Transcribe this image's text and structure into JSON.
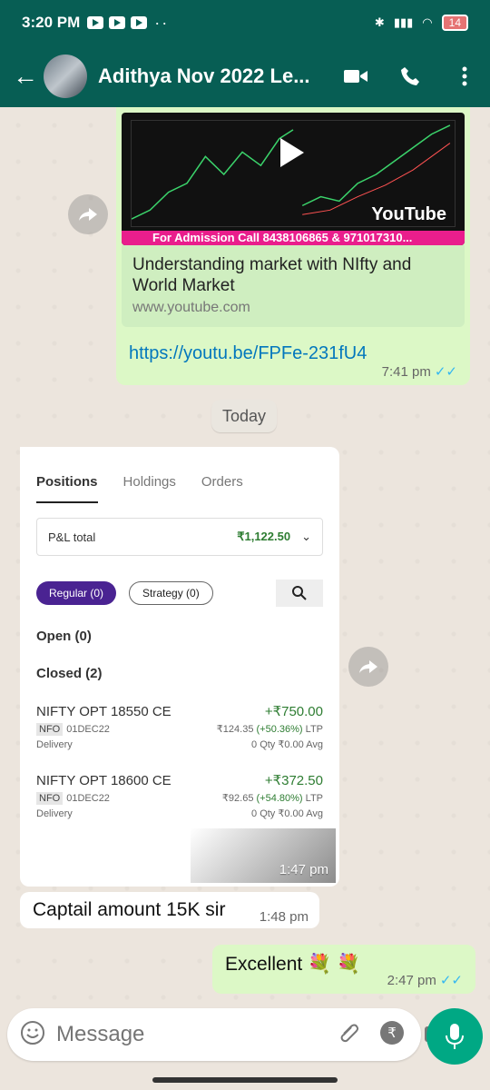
{
  "status_bar": {
    "time": "3:20 PM",
    "battery": "14"
  },
  "app_bar": {
    "title": "Adithya  Nov 2022 Le..."
  },
  "messages": {
    "link_preview": {
      "banner": "For Admission Call 8438106865 & 971017310...",
      "youtube_label": "YouTube",
      "title": "Understanding market with NIfty and World Market",
      "domain": "www.youtube.com",
      "url": "https://youtu.be/FPFe-231fU4",
      "time": "7:41 pm"
    },
    "date_divider": "Today",
    "screenshot": {
      "tabs": [
        "Positions",
        "Holdings",
        "Orders"
      ],
      "pl_label": "P&L total",
      "pl_value": "₹1,122.50",
      "chips": [
        "Regular (0)",
        "Strategy (0)"
      ],
      "open_label": "Open (0)",
      "closed_label": "Closed (2)",
      "positions": [
        {
          "symbol": "NIFTY OPT 18550 CE",
          "pnl": "+₹750.00",
          "exchange": "NFO",
          "expiry": "01DEC22",
          "ltp_price": "₹124.35",
          "ltp_change": "(+50.36%)",
          "ltp_label": "LTP",
          "product": "Delivery",
          "qty": "0 Qty",
          "avg": "₹0.00 Avg"
        },
        {
          "symbol": "NIFTY OPT 18600 CE",
          "pnl": "+₹372.50",
          "exchange": "NFO",
          "expiry": "01DEC22",
          "ltp_price": "₹92.65",
          "ltp_change": "(+54.80%)",
          "ltp_label": "LTP",
          "product": "Delivery",
          "qty": "0 Qty",
          "avg": "₹0.00 Avg"
        }
      ],
      "time": "1:47 pm"
    },
    "incoming_text": {
      "text": "Captail amount 15K sir",
      "time": "1:48 pm"
    },
    "outgoing_text": {
      "text": "Excellent 💐 💐",
      "time": "2:47 pm"
    }
  },
  "composer": {
    "placeholder": "Message"
  },
  "icons": {
    "back": "arrow-left-icon",
    "video": "video-icon",
    "call": "phone-icon",
    "more": "more-vert-icon",
    "emoji": "emoji-icon",
    "attach": "attach-icon",
    "rupee": "rupee-icon",
    "camera": "camera-icon",
    "mic": "mic-icon",
    "forward": "forward-icon"
  },
  "colors": {
    "header": "#075e54",
    "outgoing": "#dcf8c6",
    "incoming": "#ffffff",
    "accent": "#00a884",
    "tick": "#34b7f1"
  }
}
